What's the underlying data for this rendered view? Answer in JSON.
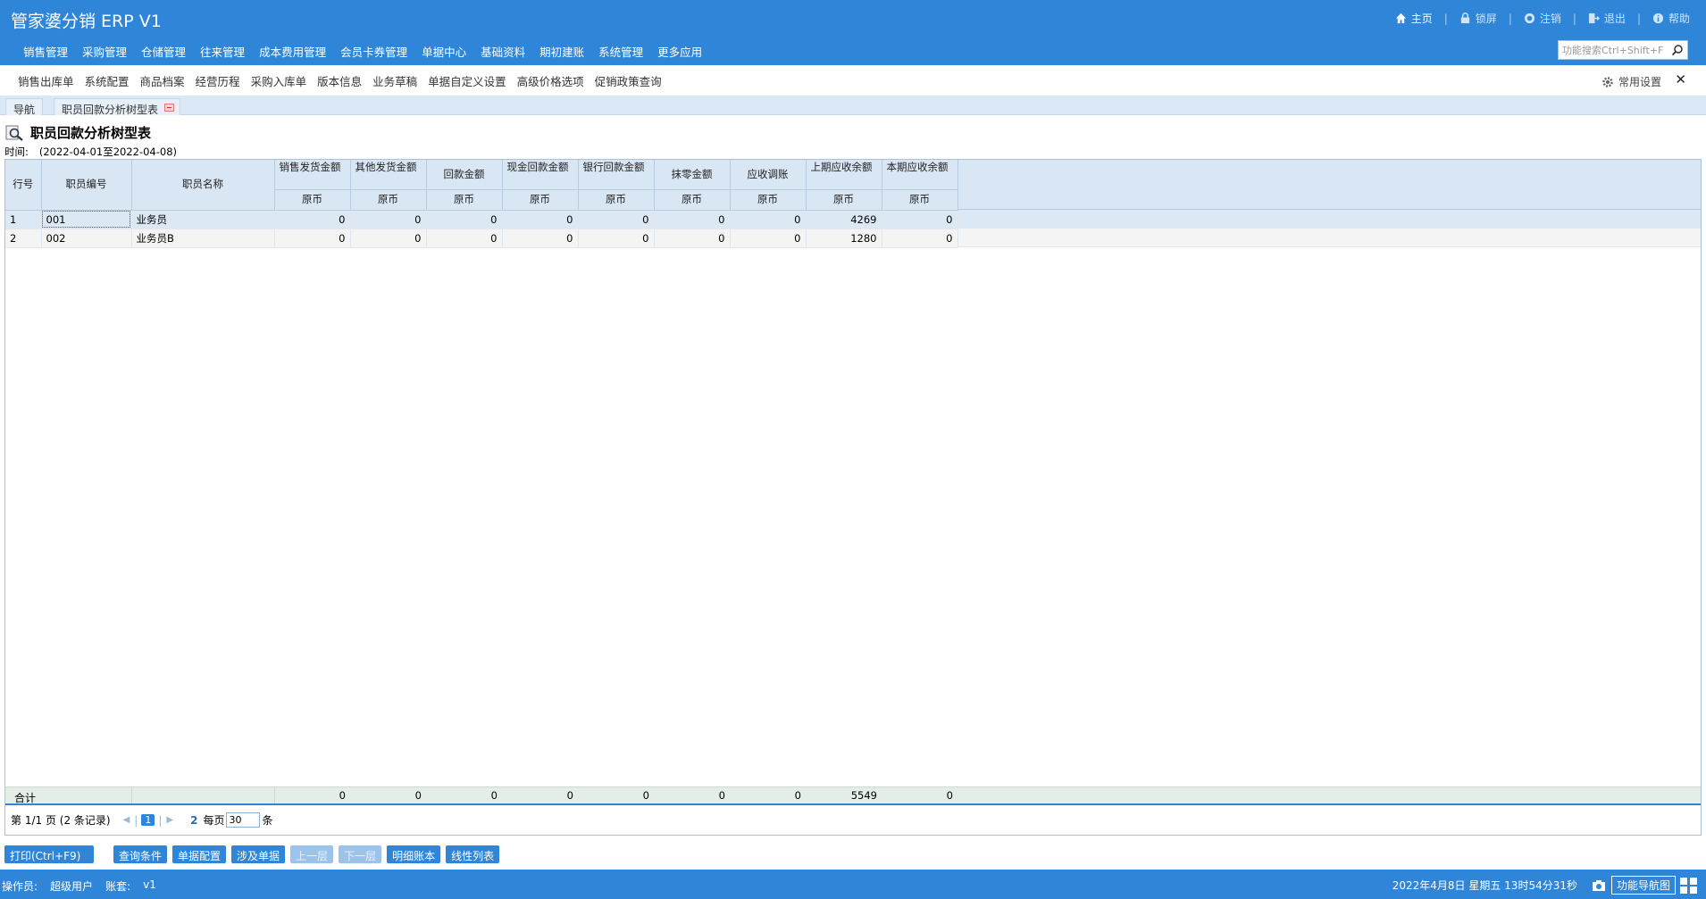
{
  "header": {
    "title": "管家婆分销 ERP V1",
    "links": [
      {
        "label": "主页",
        "icon": "home-icon"
      },
      {
        "label": "锁屏",
        "icon": "lock-icon"
      },
      {
        "label": "注销",
        "icon": "logout-circle-icon"
      },
      {
        "label": "退出",
        "icon": "exit-icon"
      },
      {
        "label": "帮助",
        "icon": "help-icon"
      }
    ],
    "menu": [
      "销售管理",
      "采购管理",
      "仓储管理",
      "往来管理",
      "成本费用管理",
      "会员卡券管理",
      "单据中心",
      "基础资料",
      "期初建账",
      "系统管理",
      "更多应用"
    ],
    "search_placeholder": "功能搜索Ctrl+Shift+F"
  },
  "shortcuts": [
    "销售出库单",
    "系统配置",
    "商品档案",
    "经营历程",
    "采购入库单",
    "版本信息",
    "业务草稿",
    "单据自定义设置",
    "高级价格选项",
    "促销政策查询"
  ],
  "common_settings_label": "常用设置",
  "close_glyph": "✕",
  "tabs": {
    "nav_label": "导航",
    "active_label": "职员回款分析树型表"
  },
  "report": {
    "title": "职员回款分析树型表",
    "time_label": "时间:",
    "time_value": "(2022-04-01至2022-04-08)"
  },
  "grid": {
    "headers": {
      "row_no": "行号",
      "emp_code": "职员编号",
      "emp_name": "职员名称",
      "sales_amount": "销售发货金额",
      "other_amount": "其他发货金额",
      "payment_amount": "回款金额",
      "cash_payment": "现金回款金额",
      "bank_payment": "银行回款金额",
      "rounding_amount": "抹零金额",
      "receivable_adjust": "应收调账",
      "prev_receivable": "上期应收余额",
      "curr_receivable": "本期应收余额",
      "currency": "原币"
    },
    "rows": [
      {
        "no": "1",
        "code": "001",
        "name": "业务员",
        "sales": "0",
        "other": "0",
        "payment": "0",
        "cash": "0",
        "bank": "0",
        "rounding": "0",
        "adjust": "0",
        "prev": "4269",
        "curr": "0"
      },
      {
        "no": "2",
        "code": "002",
        "name": "业务员B",
        "sales": "0",
        "other": "0",
        "payment": "0",
        "cash": "0",
        "bank": "0",
        "rounding": "0",
        "adjust": "0",
        "prev": "1280",
        "curr": "0"
      }
    ],
    "totals": {
      "label": "合计",
      "sales": "0",
      "other": "0",
      "payment": "0",
      "cash": "0",
      "bank": "0",
      "rounding": "0",
      "adjust": "0",
      "prev": "5549",
      "curr": "0"
    }
  },
  "pager": {
    "page_info": "第  1/1 页  (2 条记录)",
    "current_page": "1",
    "next_page": "2",
    "per_page_label": "每页",
    "per_page_value": "30",
    "unit": "条"
  },
  "actions": [
    "打印(Ctrl+F9)",
    "查询条件",
    "单据配置",
    "涉及单据",
    "上一层",
    "下一层",
    "明细账本",
    "线性列表"
  ],
  "status": {
    "operator_label": "操作员:",
    "operator": "超级用户",
    "account_label": "账套:",
    "account": "v1",
    "datetime": "2022年4月8日  星期五  13时54分31秒",
    "nav_button": "功能导航图"
  }
}
